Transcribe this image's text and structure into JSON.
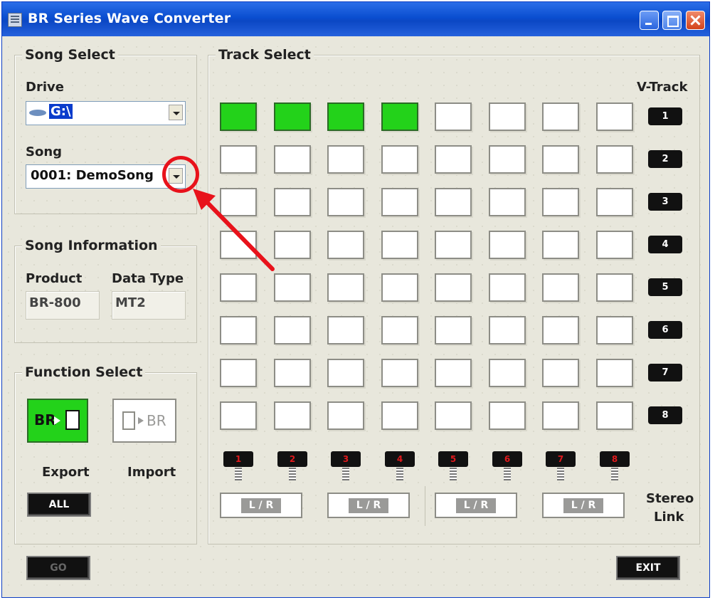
{
  "window": {
    "title": "BR Series Wave Converter"
  },
  "song_select": {
    "group_label": "Song Select",
    "drive_label": "Drive",
    "drive_value": "G:\\",
    "song_label": "Song",
    "song_value": "0001: DemoSong"
  },
  "song_info": {
    "group_label": "Song Information",
    "product_label": "Product",
    "product_value": "BR-800",
    "datatype_label": "Data Type",
    "datatype_value": "MT2"
  },
  "function_select": {
    "group_label": "Function Select",
    "export_label": "Export",
    "import_label": "Import",
    "all_label": "ALL",
    "export_icon_text": "BR",
    "import_icon_text": "BR"
  },
  "track_select": {
    "group_label": "Track Select",
    "vtrack_label": "V-Track",
    "vtracks": [
      "1",
      "2",
      "3",
      "4",
      "5",
      "6",
      "7",
      "8"
    ],
    "tracks": [
      "1",
      "2",
      "3",
      "4",
      "5",
      "6",
      "7",
      "8"
    ],
    "stereo_label_1": "Stereo",
    "stereo_label_2": "Link",
    "lr_label": "L / R",
    "selected_row1_columns": [
      1,
      2,
      3,
      4
    ]
  },
  "buttons": {
    "go": "GO",
    "exit": "EXIT"
  },
  "colors": {
    "selected": "#23d21a",
    "annotation": "#e8121b"
  }
}
